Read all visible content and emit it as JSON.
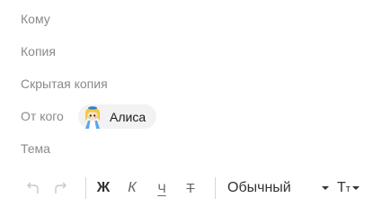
{
  "fields": {
    "to_label": "Кому",
    "cc_label": "Копия",
    "bcc_label": "Скрытая копия",
    "from_label": "От кого",
    "subject_label": "Тема"
  },
  "sender": {
    "name": "Алиса"
  },
  "toolbar": {
    "undo_icon": "undo-icon",
    "redo_icon": "redo-icon",
    "bold_label": "Ж",
    "italic_label": "К",
    "underline_label": "Ч",
    "strike_label": "Т",
    "paragraph_style": "Обычный",
    "font_size_label_big": "Т",
    "font_size_label_small": "т"
  }
}
